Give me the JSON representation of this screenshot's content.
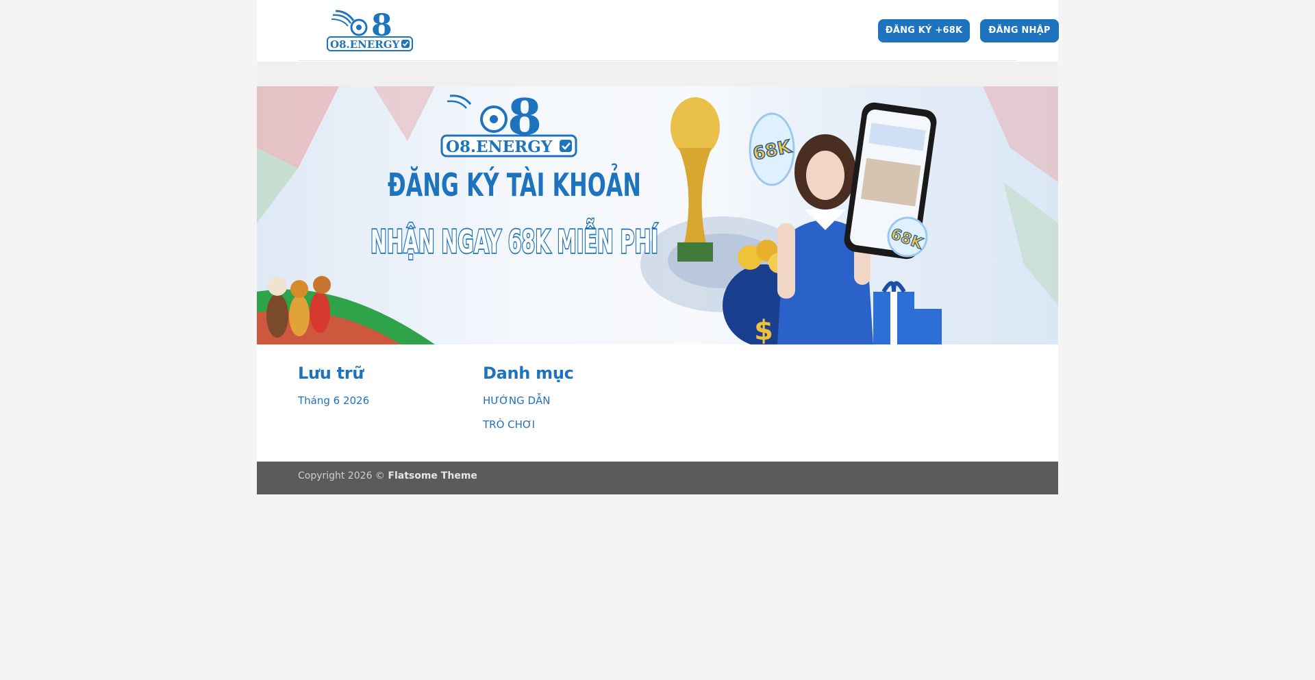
{
  "header": {
    "logo_text": "O8.ENERGY",
    "register_label": "ĐĂNG KÝ +68K",
    "login_label": "ĐĂNG NHẬP"
  },
  "banner": {
    "logo_text": "O8.ENERGY",
    "headline": "ĐĂNG KÝ TÀI KHOẢN",
    "subheadline": "NHẬN NGAY 68K MIỄN PHÍ",
    "badge_1": "68K",
    "badge_2": "68K"
  },
  "widgets": {
    "archive": {
      "title": "Lưu trữ",
      "items": [
        "Tháng 6 2026"
      ]
    },
    "categories": {
      "title": "Danh mục",
      "items": [
        "HƯỚNG DẪN",
        "TRÒ CHƠI"
      ]
    }
  },
  "footer": {
    "copyright_prefix": "Copyright 2026 © ",
    "theme_name": "Flatsome Theme"
  },
  "colors": {
    "brand_blue": "#1e73be",
    "footer_bg": "#5b5b5b",
    "page_bg": "#f4f4f4"
  }
}
